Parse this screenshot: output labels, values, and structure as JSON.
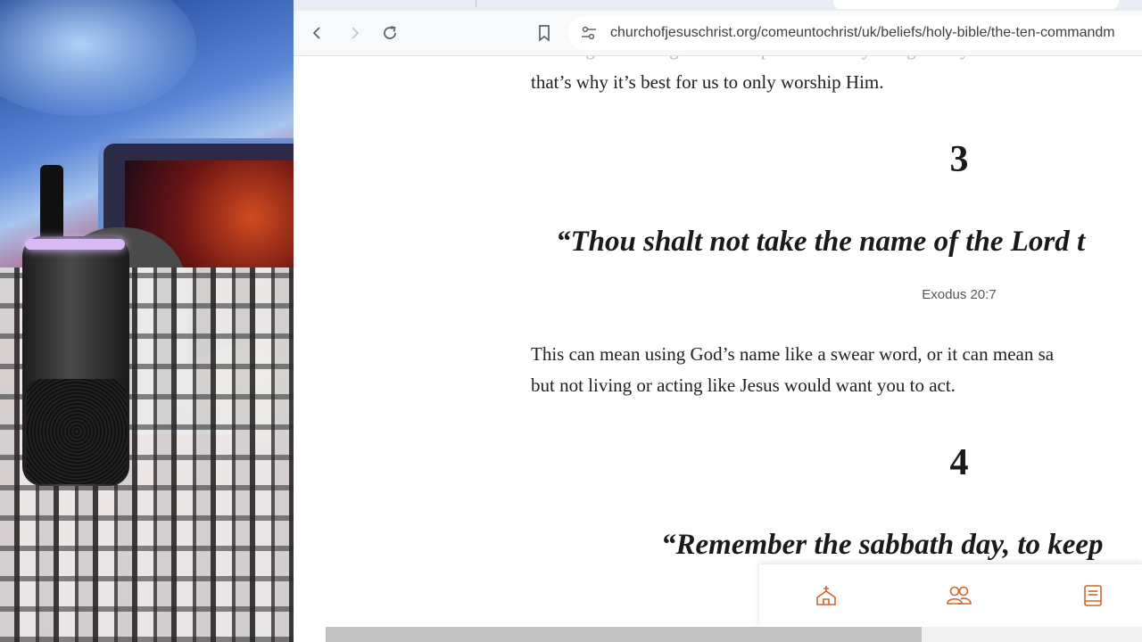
{
  "browser": {
    "url": "churchofjesuschrist.org/comeuntochrist/uk/beliefs/holy-bible/the-ten-commandm",
    "icons": {
      "back": "chevron-left-icon",
      "forward": "chevron-right-icon",
      "reload": "reload-icon",
      "bookmark": "bookmark-icon",
      "site_info": "tune-icon"
    }
  },
  "article": {
    "faded_line": "are dangerous things to worship because they can go away. But God",
    "para_1_line_2": "that’s why it’s best for us to only worship Him.",
    "commandment_3_number": "3",
    "commandment_3_quote": "“Thou shalt not take the name of the Lord t",
    "commandment_3_ref": "Exodus 20:7",
    "para_2_line_1": "This can mean using God’s name like a swear word, or it can mean sa",
    "para_2_line_2": "but not living or acting like Jesus would want you to act.",
    "commandment_4_number": "4",
    "commandment_4_quote": "“Remember the sabbath day, to keep"
  },
  "bottom_nav": {
    "accent": "#d0652b",
    "items": [
      "church-icon",
      "people-icon",
      "book-icon"
    ]
  },
  "colors": {
    "text": "#212121",
    "toolbar_bg": "#f8f9fb"
  }
}
